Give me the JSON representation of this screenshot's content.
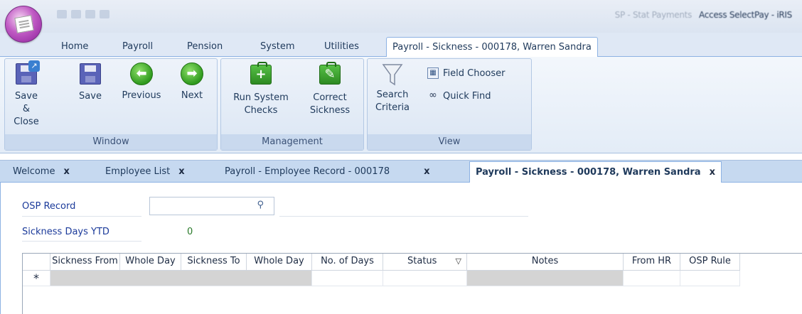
{
  "titlebar": {
    "app_title": "Access SelectPay - iRIS",
    "doc_title": "SP - Stat Payments"
  },
  "ribbon_tabs": [
    "Home",
    "Payroll",
    "Pension",
    "System",
    "Utilities",
    "Payroll - Sickness - 000178, Warren Sandra"
  ],
  "ribbon": {
    "window": {
      "label": "Window",
      "save_close": "Save &\nClose",
      "save": "Save",
      "previous": "Previous",
      "next": "Next"
    },
    "management": {
      "label": "Management",
      "run_checks": "Run System\nChecks",
      "correct_sickness": "Correct\nSickness"
    },
    "view": {
      "label": "View",
      "search_criteria": "Search\nCriteria",
      "field_chooser": "Field Chooser",
      "quick_find": "Quick Find"
    }
  },
  "doc_tabs": [
    {
      "label": "Welcome"
    },
    {
      "label": "Employee List"
    },
    {
      "label": "Payroll - Employee Record - 000178"
    },
    {
      "label": "Payroll - Sickness - 000178, Warren Sandra"
    }
  ],
  "close_glyph": "x",
  "form": {
    "osp_label": "OSP Record",
    "osp_value": "",
    "sickness_ytd_label": "Sickness Days YTD",
    "sickness_ytd_value": "0"
  },
  "grid": {
    "columns": [
      "Sickness From",
      "Whole Day",
      "Sickness To",
      "Whole Day",
      "No. of Days",
      "Status",
      "Notes",
      "From HR",
      "OSP Rule"
    ],
    "new_row_marker": "*"
  },
  "icons": {
    "save_close": "save-close-icon",
    "save": "floppy-disk-icon",
    "previous": "arrow-left-icon",
    "next": "arrow-right-icon",
    "run_checks": "medical-kit-plus-icon",
    "correct_sickness": "medical-kit-edit-icon",
    "search_criteria": "funnel-icon",
    "field_chooser": "field-chooser-icon",
    "quick_find": "binoculars-icon",
    "search": "magnifier-icon",
    "filter": "filter-icon"
  },
  "colors": {
    "ribbon_bg": "#dfe8f5",
    "link_label": "#1b3a9a",
    "value_green": "#2a7a2a",
    "new_row_grey": "#d4d4d4"
  }
}
